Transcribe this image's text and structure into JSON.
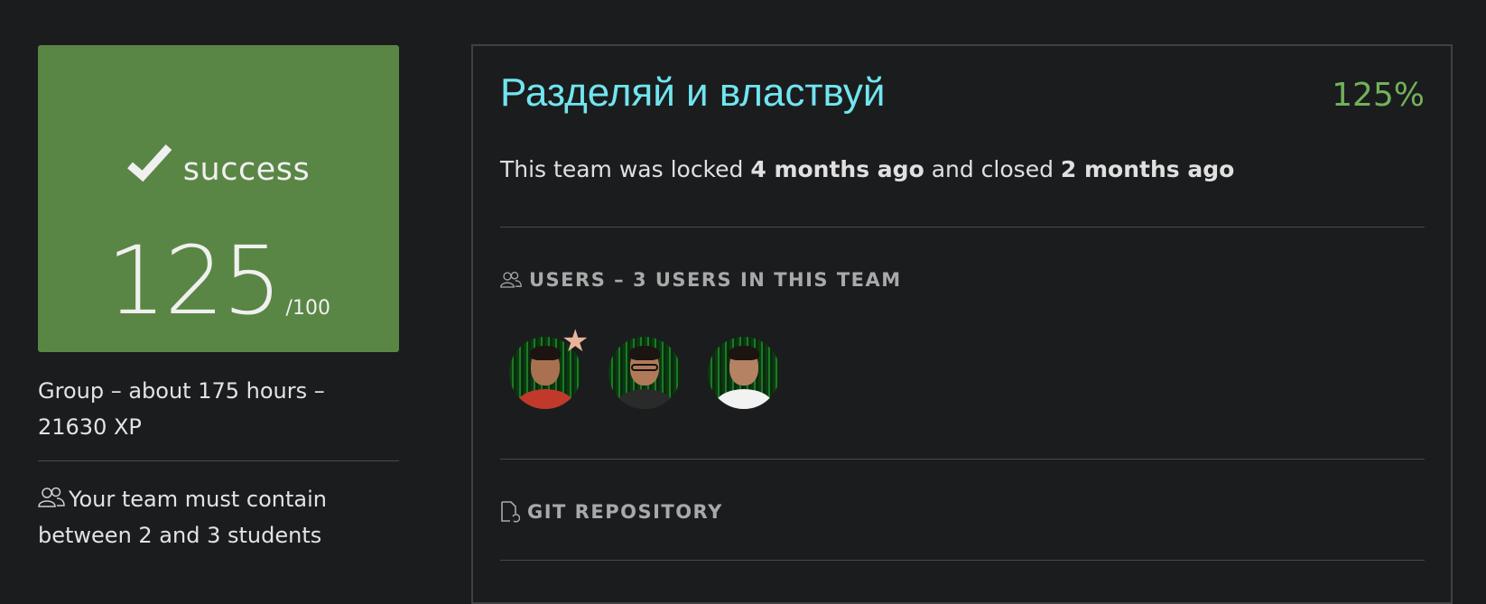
{
  "score": {
    "status": "success",
    "value": "125",
    "max": "/100",
    "bg_color": "#5a8645"
  },
  "group_info": "Group – about 175 hours – 21630 XP",
  "team_rule": "Your team must contain between 2 and 3 students",
  "project": {
    "title": "Разделяй и властвуй",
    "percent": "125%",
    "lock_prefix": "This team was locked ",
    "locked_ago": "4 months ago",
    "lock_mid": " and closed ",
    "closed_ago": "2 months ago"
  },
  "users_section": {
    "title": "USERS – 3 USERS IN THIS TEAM",
    "avatars": [
      {
        "leader": true,
        "shirt": "#c0392b"
      },
      {
        "leader": false,
        "shirt": "#2a2a2a"
      },
      {
        "leader": false,
        "shirt": "#f2f2f2"
      }
    ]
  },
  "git_section": {
    "title": "GIT REPOSITORY"
  },
  "colors": {
    "accent_title": "#71e5ef",
    "accent_percent": "#72b15b",
    "background": "#1b1c1e"
  }
}
